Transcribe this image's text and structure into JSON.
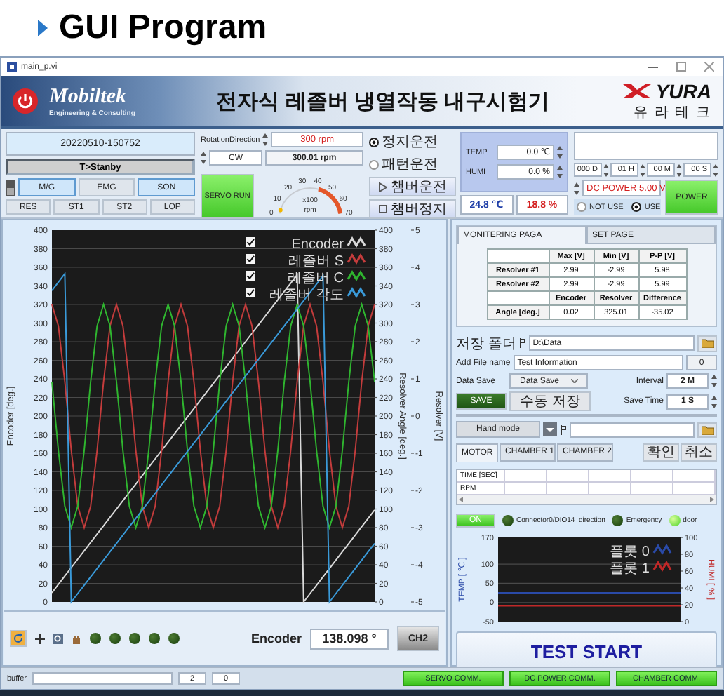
{
  "heading": {
    "title": "GUI Program"
  },
  "window": {
    "title": "main_p.vi"
  },
  "banner": {
    "company": "Mobiltek",
    "tagline": "Engineering & Consulting",
    "title": "전자식 레졸버 냉열작동 내구시험기",
    "partner": "YURA",
    "partner_sub": "유 라 테 크"
  },
  "status": {
    "timestamp": "20220510-150752",
    "state": "T>Stanby",
    "toggle_on": false,
    "mode_buttons": [
      {
        "label": "M/G",
        "on": true
      },
      {
        "label": "EMG",
        "on": false
      },
      {
        "label": "SON",
        "on": true
      }
    ],
    "signal_buttons": [
      "RES",
      "ST1",
      "ST2",
      "LOP"
    ]
  },
  "servo": {
    "direction_label": "RotationDirection",
    "speed_set": "300 rpm",
    "direction": "CW",
    "speed_reading": "300.01 rpm",
    "run_button": "SERVO RUN",
    "gauge": {
      "ticks": [
        "0",
        "10",
        "20",
        "30",
        "40",
        "50",
        "60",
        "70"
      ],
      "unit": "x100",
      "unit_2": "rpm",
      "level": 0.04
    }
  },
  "chamber": {
    "modes": [
      {
        "label": "정지운전",
        "selected": true
      },
      {
        "label": "패턴운전",
        "selected": false
      }
    ],
    "buttons": [
      {
        "label": "챔버운전",
        "kind": "play"
      },
      {
        "label": "챔버정지",
        "kind": "stop"
      }
    ],
    "settings": [
      {
        "label": "TEMP",
        "value": "0.0 ℃"
      },
      {
        "label": "HUMI",
        "value": "0.0 %"
      }
    ],
    "temp_reading": "24.8 ℃",
    "humi_reading": "18.8 %"
  },
  "power": {
    "timer": [
      "000 D",
      "01 H",
      "00 M",
      "00 S"
    ],
    "dc_power": "DC POWER 5.00 V",
    "use_options": [
      {
        "label": "NOT USE",
        "selected": false
      },
      {
        "label": "USE",
        "selected": true
      }
    ],
    "button": "POWER"
  },
  "encoder_chart": {
    "legend_checks": [
      true,
      true,
      true,
      true
    ],
    "angle_axis": {
      "label": "Resolver Angle [deg.]",
      "ticks": [
        "400",
        "380",
        "360",
        "340",
        "320",
        "300",
        "280",
        "260",
        "240",
        "220",
        "200",
        "180",
        "160",
        "140",
        "120",
        "100",
        "80",
        "60",
        "40",
        "20",
        "0"
      ]
    },
    "voltage_axis": {
      "label": "Resolver [V]",
      "ticks": [
        "5",
        "4",
        "3",
        "2",
        "1",
        "0",
        "-1",
        "-2",
        "-3",
        "-4",
        "-5"
      ]
    },
    "chart_data": {
      "type": "line",
      "grid": true,
      "legend": "upper right",
      "ylim": [
        0,
        400
      ],
      "ylabel": "Encoder [deg.]",
      "yticks": [
        0,
        20,
        40,
        60,
        80,
        100,
        120,
        140,
        160,
        180,
        200,
        220,
        240,
        260,
        280,
        300,
        320,
        340,
        360,
        380,
        400
      ],
      "categories": [
        null,
        null,
        null,
        null,
        null,
        null,
        null,
        null,
        null,
        null,
        null,
        null,
        null,
        null,
        null,
        null,
        null,
        null,
        null,
        null,
        null,
        null,
        null,
        null,
        null,
        null,
        null,
        null,
        null,
        null,
        null,
        null,
        null,
        null,
        null,
        null,
        null,
        null,
        null,
        null,
        null,
        null,
        null,
        null,
        null,
        null,
        null,
        null,
        null,
        null,
        null
      ],
      "series": [
        {
          "name": "Encoder",
          "color": "#d9d9d9",
          "values": [
            10,
            19,
            28,
            37,
            46,
            55,
            64,
            73,
            82,
            91,
            100,
            109,
            118,
            127,
            136,
            145,
            154,
            163,
            172,
            181,
            190,
            199,
            208,
            217,
            226,
            235,
            244,
            253,
            262,
            271,
            280,
            289,
            298,
            307,
            316,
            325,
            334,
            343,
            352,
            0,
            9,
            18,
            27,
            36,
            45,
            54,
            63,
            72,
            81,
            90,
            99
          ]
        },
        {
          "name": "레졸버 S",
          "color": "#c43c3c",
          "values": [
            320,
            297,
            237,
            163,
            103,
            80,
            103,
            163,
            237,
            297,
            320,
            297,
            237,
            163,
            103,
            80,
            103,
            163,
            237,
            297,
            320,
            297,
            237,
            163,
            103,
            80,
            103,
            163,
            237,
            297,
            320,
            297,
            237,
            163,
            103,
            80,
            103,
            163,
            237,
            297,
            320,
            297,
            237,
            163,
            103,
            80,
            103,
            163,
            237,
            297,
            320
          ]
        },
        {
          "name": "레졸버 C",
          "color": "#2fb52f",
          "values": [
            237,
            163,
            103,
            80,
            103,
            163,
            237,
            297,
            320,
            297,
            237,
            163,
            103,
            80,
            103,
            163,
            237,
            297,
            320,
            297,
            237,
            163,
            103,
            80,
            103,
            163,
            237,
            297,
            320,
            297,
            237,
            163,
            103,
            80,
            103,
            163,
            237,
            297,
            320,
            297,
            237,
            163,
            103,
            80,
            103,
            163,
            237,
            297,
            320,
            297,
            237
          ]
        },
        {
          "name": "레졸버 각도",
          "color": "#3a9ad9",
          "values": [
            335,
            344,
            353,
            0,
            9,
            18,
            27,
            36,
            45,
            54,
            63,
            72,
            81,
            90,
            99,
            108,
            117,
            126,
            135,
            144,
            153,
            162,
            171,
            180,
            189,
            198,
            207,
            216,
            225,
            234,
            243,
            252,
            261,
            270,
            279,
            288,
            297,
            306,
            315,
            324,
            333,
            342,
            351,
            0,
            9,
            18,
            27,
            36,
            45,
            54,
            63
          ]
        }
      ]
    }
  },
  "chart_footer": {
    "leds": [
      {
        "on": false
      },
      {
        "on": false
      },
      {
        "on": false
      },
      {
        "on": false
      },
      {
        "on": false
      }
    ],
    "encoder_label": "Encoder",
    "encoder_value": "138.098 °",
    "channel_button": "CH2"
  },
  "monitor": {
    "tabs": [
      {
        "label": "MONITERING PAGA",
        "selected": true
      },
      {
        "label": "SET PAGE",
        "selected": false
      }
    ],
    "voltage_table": {
      "columns": [
        "Max [V]",
        "Min [V]",
        "P-P [V]"
      ],
      "rows": [
        {
          "label": "Resolver #1",
          "cells": [
            "2.99",
            "-2.99",
            "5.98"
          ]
        },
        {
          "label": "Resolver #2",
          "cells": [
            "2.99",
            "-2.99",
            "5.99"
          ]
        }
      ]
    },
    "angle_table": {
      "columns": [
        "Encoder",
        "Resolver",
        "Difference"
      ],
      "rows": [
        {
          "label": "Angle [deg.]",
          "cells": [
            "0.02",
            "325.01",
            "-35.02"
          ]
        }
      ]
    }
  },
  "storage": {
    "folder_label": "저장 폴더",
    "folder": "D:\\Data",
    "file_label": "Add File name",
    "file_name": "Test Information",
    "count": "0",
    "data_save_label": "Data Save",
    "data_save": "Data Save",
    "interval_label": "Interval",
    "interval": "2 M",
    "save_button": "SAVE",
    "manual_save": "수동 저장",
    "save_time_label": "Save Time",
    "save_time": "1 S"
  },
  "manual": {
    "mode": "Hand mode",
    "tabs": [
      {
        "label": "MOTOR",
        "selected": true
      },
      {
        "label": "CHAMBER 1",
        "selected": false
      },
      {
        "label": "CHAMBER 2",
        "selected": false
      }
    ],
    "buttons": [
      "확인",
      "취소"
    ],
    "table_rows": [
      "TIME [SEC]",
      "RPM"
    ]
  },
  "indicators": {
    "on_button": "ON",
    "lamps": [
      {
        "label": "Connector0/DIO14_direction",
        "on": false
      },
      {
        "label": "Emergency",
        "on": false
      },
      {
        "label": "door",
        "on": true
      }
    ]
  },
  "env_chart": {
    "humidity_axis": {
      "label": "HUMI [ % ]",
      "ticks": [
        "100",
        "80",
        "60",
        "40",
        "20",
        "0"
      ]
    },
    "chart_data": {
      "type": "line",
      "grid": true,
      "legend": "upper right",
      "ylim": [
        -50,
        170
      ],
      "ylabel": "TEMP [ ℃ ]",
      "yticks": [
        -50,
        0,
        50,
        100,
        170
      ],
      "categories": [
        null,
        null,
        null,
        null,
        null,
        null,
        null,
        null,
        null,
        null,
        null
      ],
      "series": [
        {
          "name": "플롯 0",
          "color": "#2a4aa8",
          "values": [
            25,
            25,
            25,
            25,
            25,
            25,
            25,
            25,
            25,
            25,
            25
          ]
        },
        {
          "name": "플롯 1",
          "color": "#c02828",
          "values": [
            -9,
            -9,
            -9,
            -9,
            -9,
            -9,
            -9,
            -9,
            -9,
            -9,
            -9
          ]
        }
      ]
    }
  },
  "test_button": "TEST START",
  "status_bar": {
    "buffer_label": "buffer",
    "values": [
      "2",
      "0"
    ],
    "comms": [
      "SERVO COMM.",
      "DC POWER COMM.",
      "CHAMBER COMM."
    ]
  }
}
